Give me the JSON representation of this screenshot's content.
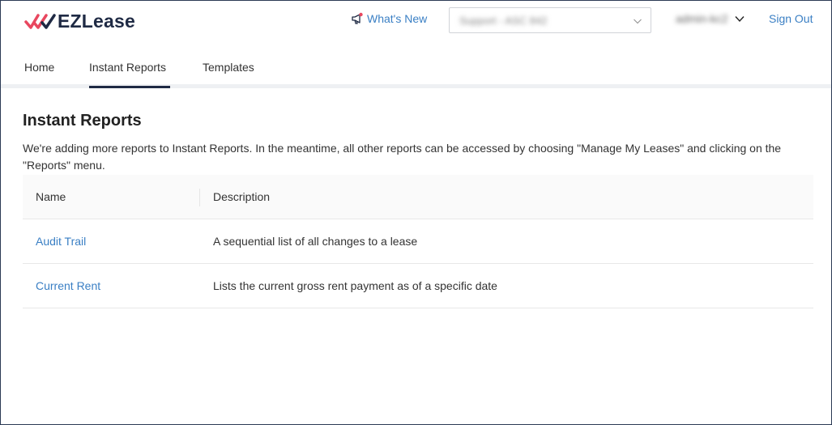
{
  "header": {
    "logo_text": "EZLease",
    "whats_new_label": "What's New",
    "account_select_value": "Support - ASC 842",
    "user_name": "admin-kc2",
    "sign_out_label": "Sign Out",
    "colors": {
      "brand_red": "#e8475f",
      "brand_navy": "#1f2a44",
      "link_blue": "#3a7fc4"
    }
  },
  "nav": {
    "tabs": [
      {
        "label": "Home"
      },
      {
        "label": "Instant Reports",
        "active": true
      },
      {
        "label": "Templates"
      }
    ]
  },
  "main": {
    "title": "Instant Reports",
    "intro": "We're adding more reports to Instant Reports. In the meantime, all other reports can be accessed by choosing \"Manage My Leases\" and clicking on the \"Reports\" menu.",
    "table": {
      "columns": [
        "Name",
        "Description"
      ],
      "rows": [
        {
          "name": "Audit Trail",
          "description": "A sequential list of all changes to a lease"
        },
        {
          "name": "Current Rent",
          "description": "Lists the current gross rent payment as of a specific date"
        }
      ]
    }
  }
}
